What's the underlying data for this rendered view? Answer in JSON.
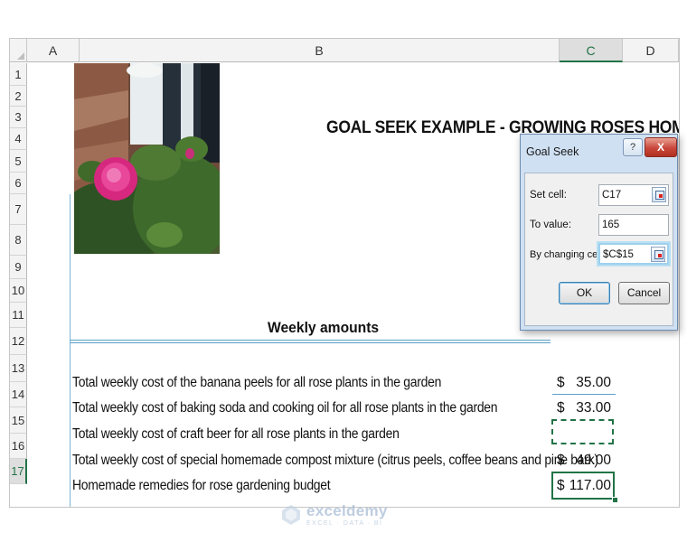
{
  "columns": [
    "A",
    "B",
    "C",
    "D"
  ],
  "active_column": "C",
  "rows": [
    "1",
    "2",
    "3",
    "4",
    "5",
    "6",
    "7",
    "8",
    "9",
    "10",
    "11",
    "12",
    "13",
    "14",
    "15",
    "16",
    "17"
  ],
  "active_row": "17",
  "sheet": {
    "title": "GOAL SEEK EXAMPLE - GROWING ROSES HOMEMAD",
    "subtitle": "Weekly amounts",
    "items": [
      {
        "label": "Total weekly cost of the banana peels for all rose plants in the garden",
        "currency": "$",
        "amount": "35.00"
      },
      {
        "label": "Total weekly cost of baking soda and cooking oil for all rose plants in the garden",
        "currency": "$",
        "amount": "33.00"
      },
      {
        "label": "Total weekly cost of craft beer for all rose plants in the garden",
        "currency": "",
        "amount": ""
      },
      {
        "label": "Total weekly cost of special homemade compost mixture (citrus peels, coffee beans and pine bark)",
        "currency": "$",
        "amount": "49.00"
      },
      {
        "label": "Homemade remedies for rose gardening budget",
        "currency": "$",
        "amount": "117.00"
      }
    ]
  },
  "dialog": {
    "title": "Goal Seek",
    "help": "?",
    "close": "X",
    "set_cell_label": "Set cell:",
    "set_cell_value": "C17",
    "to_value_label": "To value:",
    "to_value_value": "165",
    "changing_cell_label": "By changing cell:",
    "changing_cell_value": "$C$15",
    "ok": "OK",
    "cancel": "Cancel"
  },
  "watermark": {
    "name": "exceldemy",
    "tagline": "EXCEL · DATA · BI"
  },
  "colors": {
    "accent": "#217346",
    "line_blue": "#5aa0c8"
  }
}
